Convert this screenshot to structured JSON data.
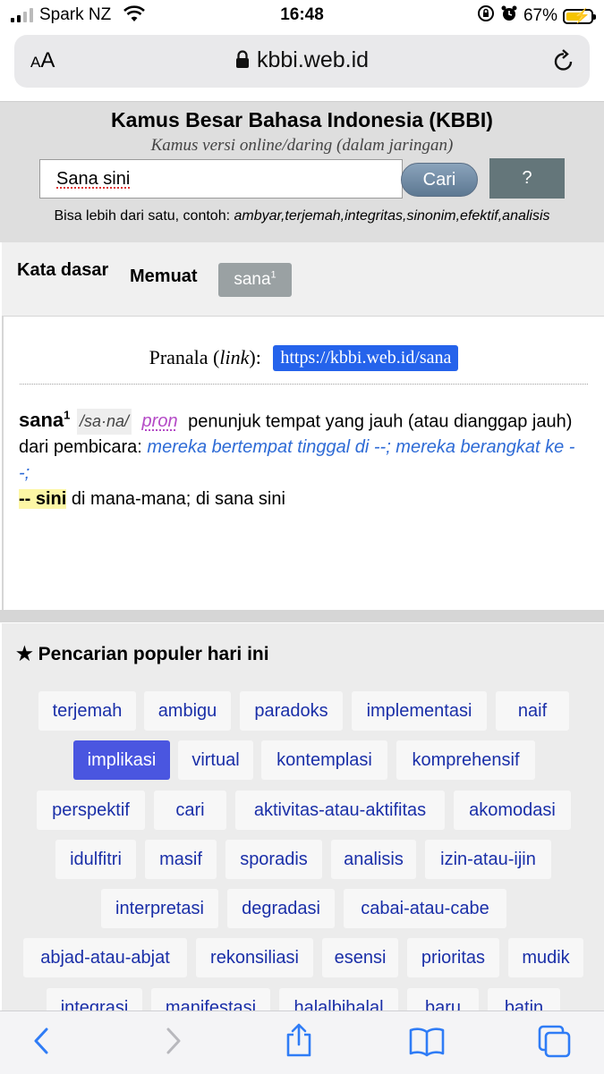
{
  "status_bar": {
    "carrier": "Spark NZ",
    "time": "16:48",
    "battery_percent": "67%",
    "battery_level": 0.67
  },
  "address_bar": {
    "aa_label_small": "A",
    "aa_label_large": "A",
    "domain": "kbbi.web.id"
  },
  "header": {
    "title": "Kamus Besar Bahasa Indonesia (KBBI)",
    "subtitle": "Kamus versi online/daring (dalam jaringan)",
    "search_value": "Sana sini",
    "search_button": "Cari",
    "help_button": "?",
    "hint_prefix": "Bisa lebih dari satu, contoh:",
    "hint_examples": "ambyar,terjemah,integritas,sinonim,efektif,analisis"
  },
  "tabs": {
    "kata_dasar": "Kata dasar",
    "memuat": "Memuat",
    "word": "sana",
    "word_sup": "1"
  },
  "result": {
    "pranala_label": "Pranala (",
    "pranala_link_word": "link",
    "pranala_suffix": "):",
    "pranala_url": "https://kbbi.web.id/sana",
    "headword": "sana",
    "headword_sup": "1",
    "pronunciation": "/sa·na/",
    "pos": "pron",
    "definition": "penunjuk tempat yang jauh (atau dianggap jauh) dari pembicara:",
    "example": "mereka bertempat tinggal di --; mereka berangkat ke --;",
    "subentry_term": "-- sini",
    "subentry_definition": "di mana-mana; di sana sini"
  },
  "popular": {
    "title": "Pencarian populer hari ini",
    "items": [
      "terjemah",
      "ambigu",
      "paradoks",
      "implementasi",
      "naif",
      "implikasi",
      "virtual",
      "kontemplasi",
      "komprehensif",
      "perspektif",
      "cari",
      "aktivitas-atau-aktifitas",
      "akomodasi",
      "idulfitri",
      "masif",
      "sporadis",
      "analisis",
      "izin-atau-ijin",
      "interpretasi",
      "degradasi",
      "cabai-atau-cabe",
      "abjad-atau-abjat",
      "rekonsiliasi",
      "esensi",
      "prioritas",
      "mudik",
      "integrasi",
      "manifestasi",
      "halalbihalal",
      "baru",
      "batin"
    ],
    "active_item": "implikasi"
  }
}
